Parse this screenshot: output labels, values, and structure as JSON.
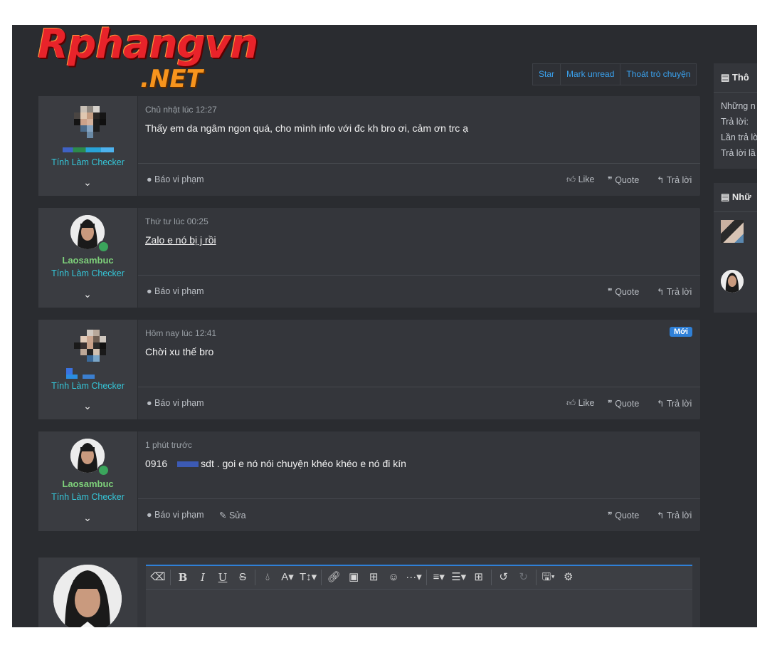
{
  "site": {
    "logo_main": "Rphangvn",
    "logo_sub": ".NET"
  },
  "thread_actions": {
    "star": "Star",
    "mark_unread": "Mark unread",
    "leave": "Thoát trò chuyện"
  },
  "posts": [
    {
      "date": "Chủ nhật lúc 12:27",
      "message": "Thấy em da ngâm ngon quá, cho mình info với đc kh bro ơi, cảm ơn trc ạ",
      "user_title": "Tính Làm Checker",
      "report": "Báo vi phạm",
      "like": "Like",
      "quote": "Quote",
      "reply": "Trả lời"
    },
    {
      "date": "Thứ tư lúc 00:25",
      "message": "Zalo e nó bị j rồi",
      "username": "Laosambuc",
      "user_title": "Tính Làm Checker",
      "report": "Báo vi phạm",
      "quote": "Quote",
      "reply": "Trả lời"
    },
    {
      "date": "Hôm nay lúc 12:41",
      "badge": "Mới",
      "message": "Chời xu thế bro",
      "user_title": "Tính Làm Checker",
      "report": "Báo vi phạm",
      "like": "Like",
      "quote": "Quote",
      "reply": "Trả lời"
    },
    {
      "date": "1 phút trước",
      "message_prefix": "0916",
      "message": "sdt . goi e nó nói chuyện khéo khéo e nó đi kín",
      "username": "Laosambuc",
      "user_title": "Tính Làm Checker",
      "report": "Báo vi phạm",
      "edit": "Sửa",
      "quote": "Quote",
      "reply": "Trả lời"
    }
  ],
  "sidebar": {
    "box1": {
      "title": "Thô",
      "lines": [
        "Những n",
        "Trả lời:",
        "Lần trả lờ",
        "Trả lời lầ"
      ]
    },
    "box2": {
      "title": "Nhữ"
    }
  },
  "editor": {
    "icons": [
      "eraser-icon",
      "bold-icon",
      "italic-icon",
      "underline-icon",
      "strike-icon",
      "color-icon",
      "font-size-icon",
      "text-height-icon",
      "link-icon",
      "image-icon",
      "video-icon",
      "emoji-icon",
      "more-icon",
      "align-icon",
      "list-icon",
      "table-icon",
      "undo-icon",
      "redo-icon",
      "save-draft-icon",
      "settings-icon"
    ]
  }
}
